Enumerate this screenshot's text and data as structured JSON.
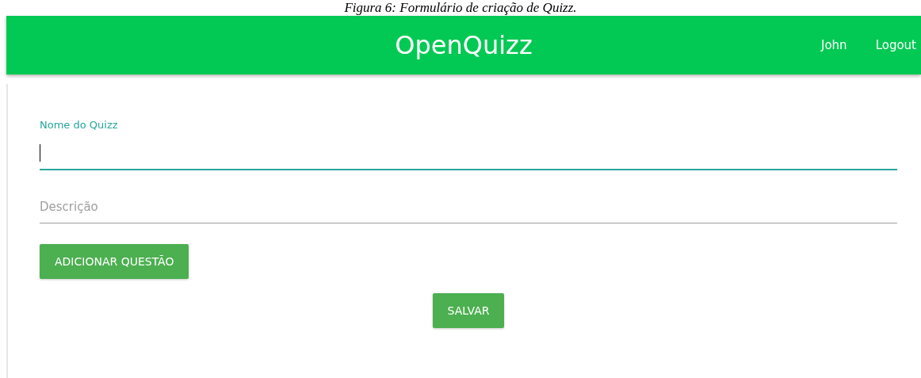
{
  "caption": "Figura 6: Formulário de criação de Quizz.",
  "navbar": {
    "brand": "OpenQuizz",
    "links": [
      "John",
      "Logout"
    ]
  },
  "form": {
    "fields": [
      {
        "label": "Nome do Quizz",
        "focused": true
      },
      {
        "placeholder": "Descrição",
        "focused": false
      }
    ],
    "add_button": "ADICIONAR QUESTÃO",
    "save_button": "SALVAR"
  }
}
